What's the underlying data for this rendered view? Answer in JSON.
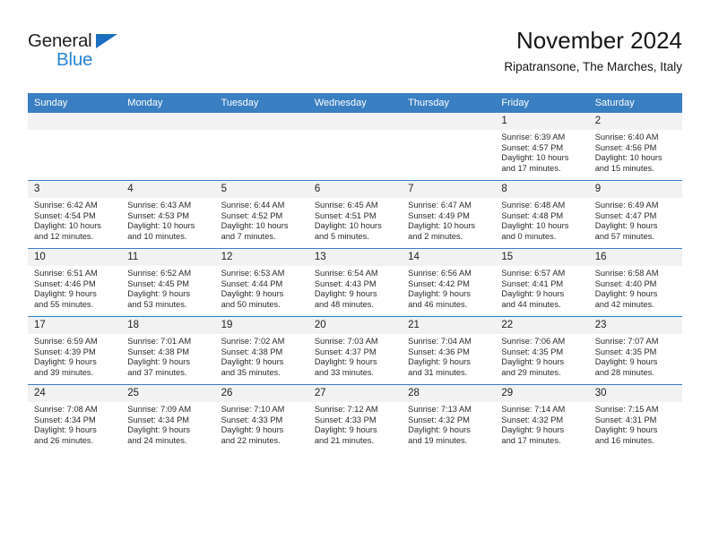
{
  "brand": {
    "word_top": "General",
    "word_bottom": "Blue",
    "triangle_color": "#1c6fc0",
    "blue_color": "#2a86d8"
  },
  "header": {
    "title": "November 2024",
    "subtitle": "Ripatransone, The Marches, Italy"
  },
  "theme": {
    "header_blue": "#3a7fc1",
    "daynum_band": "#f2f2f2"
  },
  "weekdays": [
    "Sunday",
    "Monday",
    "Tuesday",
    "Wednesday",
    "Thursday",
    "Friday",
    "Saturday"
  ],
  "labels": {
    "sunrise": "Sunrise:",
    "sunset": "Sunset:",
    "daylight": "Daylight:"
  },
  "weeks": [
    [
      {
        "day": "",
        "blank": true
      },
      {
        "day": "",
        "blank": true
      },
      {
        "day": "",
        "blank": true
      },
      {
        "day": "",
        "blank": true
      },
      {
        "day": "",
        "blank": true
      },
      {
        "day": "1",
        "sunrise": "Sunrise: 6:39 AM",
        "sunset": "Sunset: 4:57 PM",
        "daylight1": "Daylight: 10 hours",
        "daylight2": "and 17 minutes."
      },
      {
        "day": "2",
        "sunrise": "Sunrise: 6:40 AM",
        "sunset": "Sunset: 4:56 PM",
        "daylight1": "Daylight: 10 hours",
        "daylight2": "and 15 minutes."
      }
    ],
    [
      {
        "day": "3",
        "sunrise": "Sunrise: 6:42 AM",
        "sunset": "Sunset: 4:54 PM",
        "daylight1": "Daylight: 10 hours",
        "daylight2": "and 12 minutes."
      },
      {
        "day": "4",
        "sunrise": "Sunrise: 6:43 AM",
        "sunset": "Sunset: 4:53 PM",
        "daylight1": "Daylight: 10 hours",
        "daylight2": "and 10 minutes."
      },
      {
        "day": "5",
        "sunrise": "Sunrise: 6:44 AM",
        "sunset": "Sunset: 4:52 PM",
        "daylight1": "Daylight: 10 hours",
        "daylight2": "and 7 minutes."
      },
      {
        "day": "6",
        "sunrise": "Sunrise: 6:45 AM",
        "sunset": "Sunset: 4:51 PM",
        "daylight1": "Daylight: 10 hours",
        "daylight2": "and 5 minutes."
      },
      {
        "day": "7",
        "sunrise": "Sunrise: 6:47 AM",
        "sunset": "Sunset: 4:49 PM",
        "daylight1": "Daylight: 10 hours",
        "daylight2": "and 2 minutes."
      },
      {
        "day": "8",
        "sunrise": "Sunrise: 6:48 AM",
        "sunset": "Sunset: 4:48 PM",
        "daylight1": "Daylight: 10 hours",
        "daylight2": "and 0 minutes."
      },
      {
        "day": "9",
        "sunrise": "Sunrise: 6:49 AM",
        "sunset": "Sunset: 4:47 PM",
        "daylight1": "Daylight: 9 hours",
        "daylight2": "and 57 minutes."
      }
    ],
    [
      {
        "day": "10",
        "sunrise": "Sunrise: 6:51 AM",
        "sunset": "Sunset: 4:46 PM",
        "daylight1": "Daylight: 9 hours",
        "daylight2": "and 55 minutes."
      },
      {
        "day": "11",
        "sunrise": "Sunrise: 6:52 AM",
        "sunset": "Sunset: 4:45 PM",
        "daylight1": "Daylight: 9 hours",
        "daylight2": "and 53 minutes."
      },
      {
        "day": "12",
        "sunrise": "Sunrise: 6:53 AM",
        "sunset": "Sunset: 4:44 PM",
        "daylight1": "Daylight: 9 hours",
        "daylight2": "and 50 minutes."
      },
      {
        "day": "13",
        "sunrise": "Sunrise: 6:54 AM",
        "sunset": "Sunset: 4:43 PM",
        "daylight1": "Daylight: 9 hours",
        "daylight2": "and 48 minutes."
      },
      {
        "day": "14",
        "sunrise": "Sunrise: 6:56 AM",
        "sunset": "Sunset: 4:42 PM",
        "daylight1": "Daylight: 9 hours",
        "daylight2": "and 46 minutes."
      },
      {
        "day": "15",
        "sunrise": "Sunrise: 6:57 AM",
        "sunset": "Sunset: 4:41 PM",
        "daylight1": "Daylight: 9 hours",
        "daylight2": "and 44 minutes."
      },
      {
        "day": "16",
        "sunrise": "Sunrise: 6:58 AM",
        "sunset": "Sunset: 4:40 PM",
        "daylight1": "Daylight: 9 hours",
        "daylight2": "and 42 minutes."
      }
    ],
    [
      {
        "day": "17",
        "sunrise": "Sunrise: 6:59 AM",
        "sunset": "Sunset: 4:39 PM",
        "daylight1": "Daylight: 9 hours",
        "daylight2": "and 39 minutes."
      },
      {
        "day": "18",
        "sunrise": "Sunrise: 7:01 AM",
        "sunset": "Sunset: 4:38 PM",
        "daylight1": "Daylight: 9 hours",
        "daylight2": "and 37 minutes."
      },
      {
        "day": "19",
        "sunrise": "Sunrise: 7:02 AM",
        "sunset": "Sunset: 4:38 PM",
        "daylight1": "Daylight: 9 hours",
        "daylight2": "and 35 minutes."
      },
      {
        "day": "20",
        "sunrise": "Sunrise: 7:03 AM",
        "sunset": "Sunset: 4:37 PM",
        "daylight1": "Daylight: 9 hours",
        "daylight2": "and 33 minutes."
      },
      {
        "day": "21",
        "sunrise": "Sunrise: 7:04 AM",
        "sunset": "Sunset: 4:36 PM",
        "daylight1": "Daylight: 9 hours",
        "daylight2": "and 31 minutes."
      },
      {
        "day": "22",
        "sunrise": "Sunrise: 7:06 AM",
        "sunset": "Sunset: 4:35 PM",
        "daylight1": "Daylight: 9 hours",
        "daylight2": "and 29 minutes."
      },
      {
        "day": "23",
        "sunrise": "Sunrise: 7:07 AM",
        "sunset": "Sunset: 4:35 PM",
        "daylight1": "Daylight: 9 hours",
        "daylight2": "and 28 minutes."
      }
    ],
    [
      {
        "day": "24",
        "sunrise": "Sunrise: 7:08 AM",
        "sunset": "Sunset: 4:34 PM",
        "daylight1": "Daylight: 9 hours",
        "daylight2": "and 26 minutes."
      },
      {
        "day": "25",
        "sunrise": "Sunrise: 7:09 AM",
        "sunset": "Sunset: 4:34 PM",
        "daylight1": "Daylight: 9 hours",
        "daylight2": "and 24 minutes."
      },
      {
        "day": "26",
        "sunrise": "Sunrise: 7:10 AM",
        "sunset": "Sunset: 4:33 PM",
        "daylight1": "Daylight: 9 hours",
        "daylight2": "and 22 minutes."
      },
      {
        "day": "27",
        "sunrise": "Sunrise: 7:12 AM",
        "sunset": "Sunset: 4:33 PM",
        "daylight1": "Daylight: 9 hours",
        "daylight2": "and 21 minutes."
      },
      {
        "day": "28",
        "sunrise": "Sunrise: 7:13 AM",
        "sunset": "Sunset: 4:32 PM",
        "daylight1": "Daylight: 9 hours",
        "daylight2": "and 19 minutes."
      },
      {
        "day": "29",
        "sunrise": "Sunrise: 7:14 AM",
        "sunset": "Sunset: 4:32 PM",
        "daylight1": "Daylight: 9 hours",
        "daylight2": "and 17 minutes."
      },
      {
        "day": "30",
        "sunrise": "Sunrise: 7:15 AM",
        "sunset": "Sunset: 4:31 PM",
        "daylight1": "Daylight: 9 hours",
        "daylight2": "and 16 minutes."
      }
    ]
  ]
}
